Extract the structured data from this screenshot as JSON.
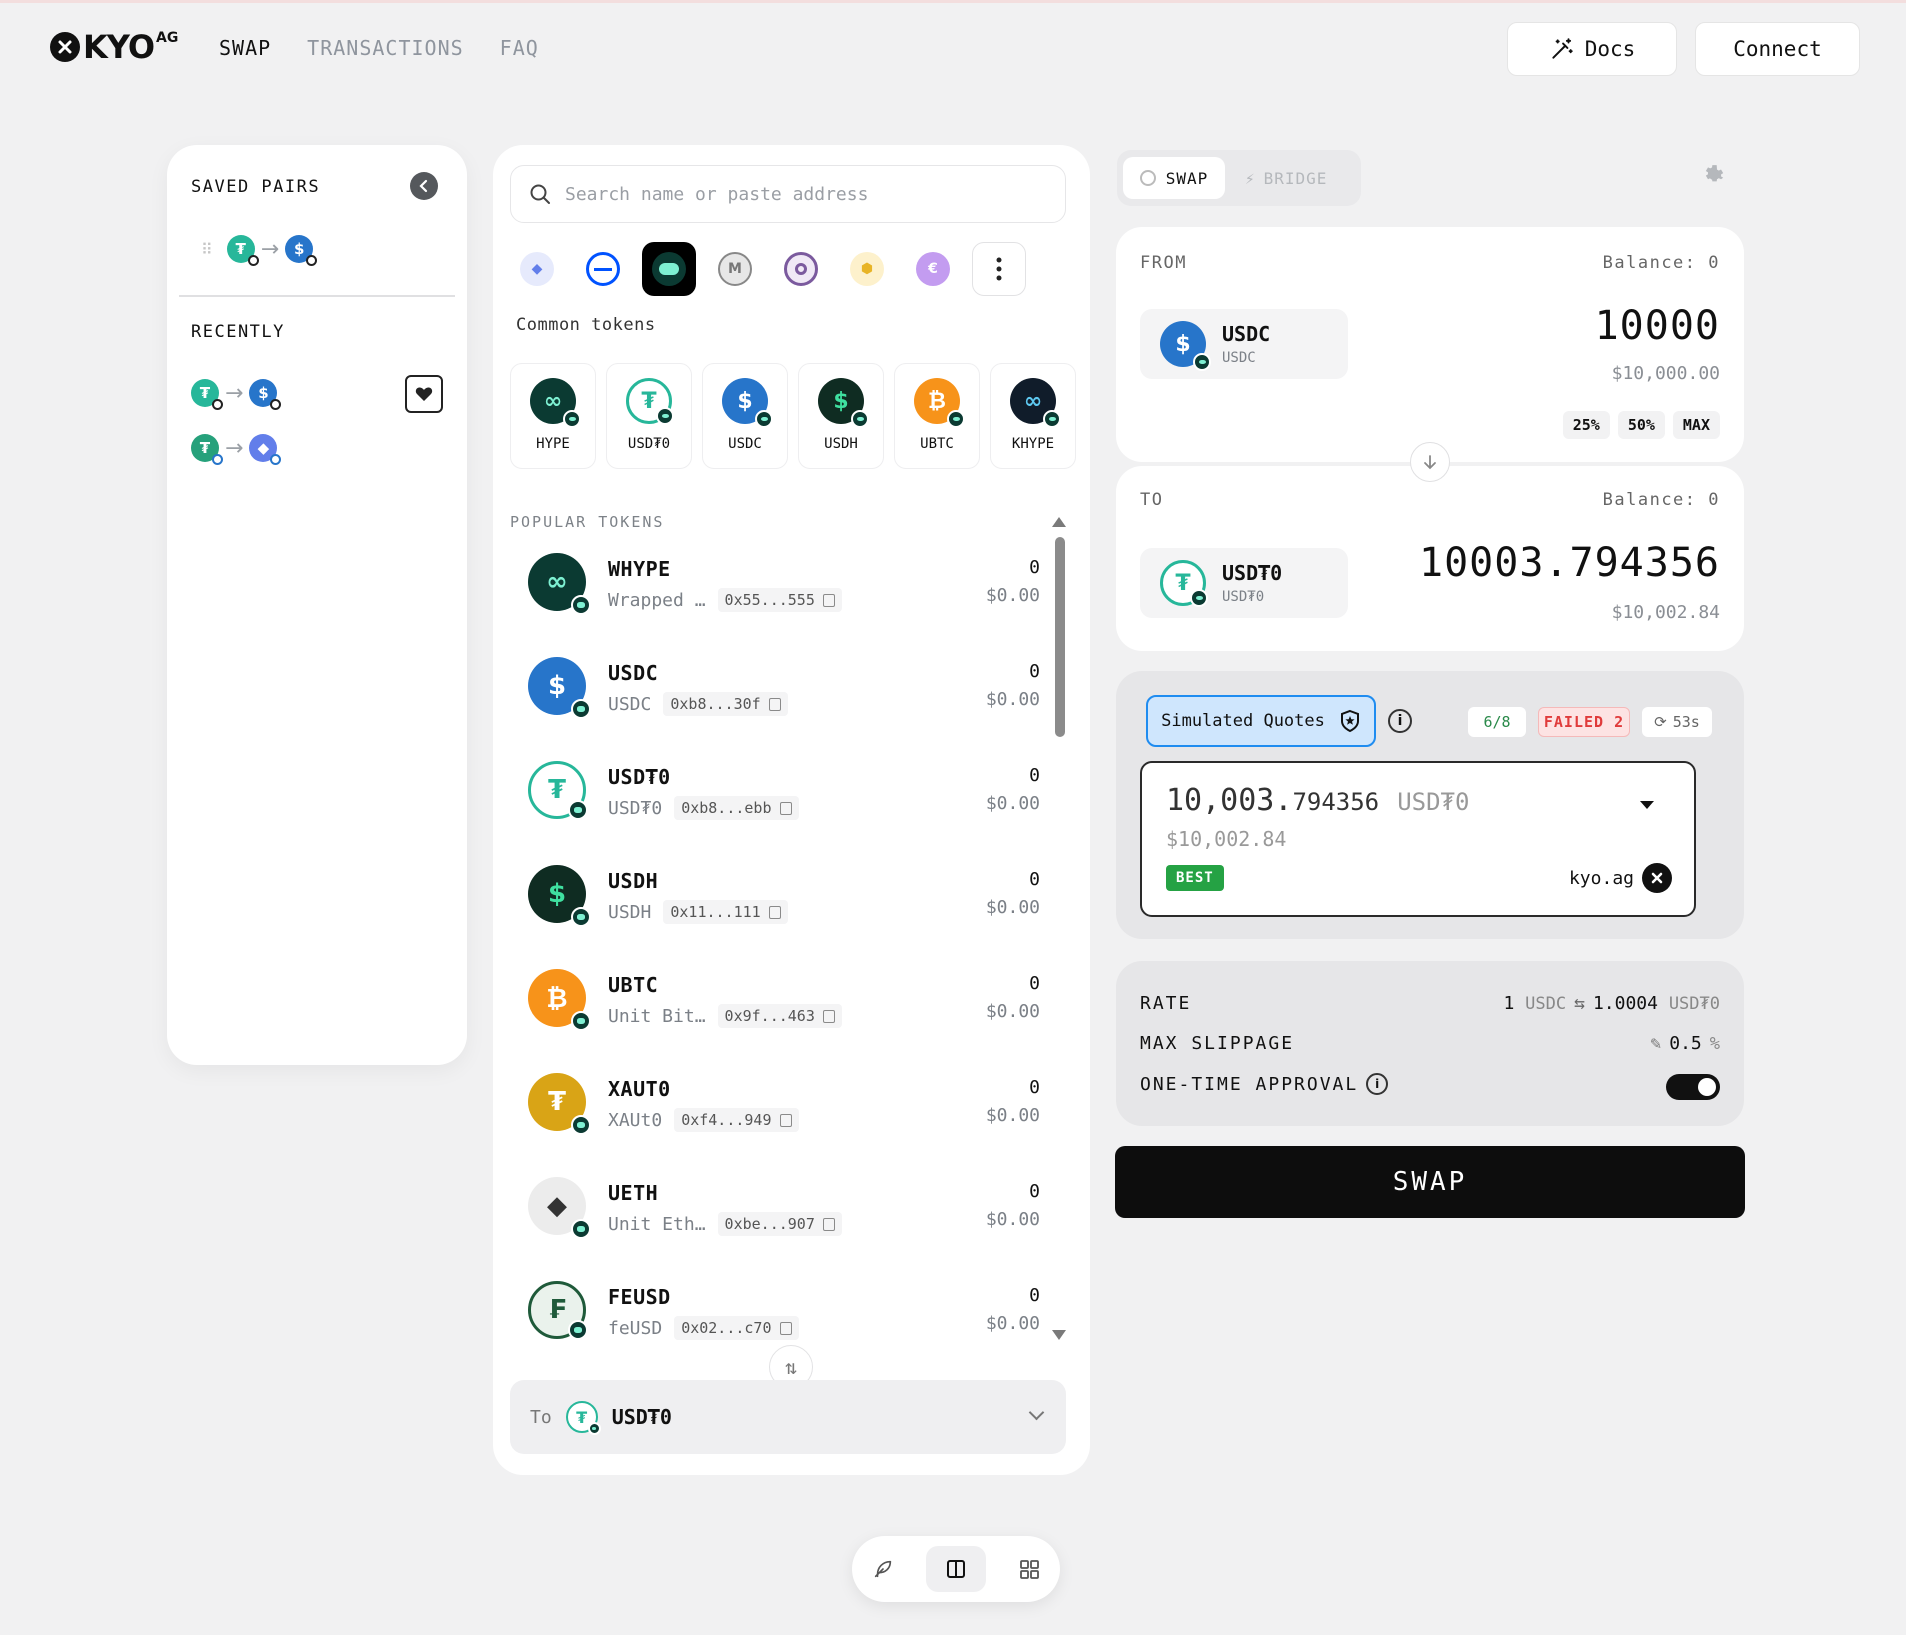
{
  "app": {
    "logo_text": "KYO",
    "logo_sup": "AG"
  },
  "nav": {
    "swap": "SWAP",
    "transactions": "TRANSACTIONS",
    "faq": "FAQ"
  },
  "header": {
    "docs_label": "Docs",
    "connect_label": "Connect"
  },
  "saved": {
    "title": "SAVED PAIRS",
    "recent_title": "RECENTLY"
  },
  "token_selector": {
    "search_placeholder": "Search name or paste address",
    "common_label": "Common tokens",
    "popular_label": "POPULAR TOKENS",
    "chains": [
      "ethereum",
      "base",
      "hyperliquid",
      "mantle",
      "hyperevm-circle",
      "bnb",
      "ethena"
    ],
    "common_tokens": [
      {
        "symbol": "HYPE",
        "color": "#0b3a32",
        "glyph": "∞"
      },
      {
        "symbol": "USD₮0",
        "color": "#27b79a",
        "glyph": "₮"
      },
      {
        "symbol": "USDC",
        "color": "#2775ca",
        "glyph": "$"
      },
      {
        "symbol": "USDH",
        "color": "#0f2c22",
        "glyph": "$"
      },
      {
        "symbol": "UBTC",
        "color": "#f7931a",
        "glyph": "₿"
      },
      {
        "symbol": "KHYPE",
        "color": "#101c2a",
        "glyph": "∞"
      }
    ],
    "popular_tokens": [
      {
        "symbol": "WHYPE",
        "name": "Wrapped …",
        "address": "0x55...555",
        "balance": "0",
        "usd": "$0.00",
        "color": "#0b3a32",
        "glyph": "∞"
      },
      {
        "symbol": "USDC",
        "name": "USDC",
        "address": "0xb8...30f",
        "balance": "0",
        "usd": "$0.00",
        "color": "#2775ca",
        "glyph": "$"
      },
      {
        "symbol": "USD₮0",
        "name": "USD₮0",
        "address": "0xb8...ebb",
        "balance": "0",
        "usd": "$0.00",
        "color": "#27b79a",
        "glyph": "₮"
      },
      {
        "symbol": "USDH",
        "name": "USDH",
        "address": "0x11...111",
        "balance": "0",
        "usd": "$0.00",
        "color": "#0f2c22",
        "glyph": "$"
      },
      {
        "symbol": "UBTC",
        "name": "Unit Bit…",
        "address": "0x9f...463",
        "balance": "0",
        "usd": "$0.00",
        "color": "#f7931a",
        "glyph": "₿"
      },
      {
        "symbol": "XAUT0",
        "name": "XAUt0",
        "address": "0xf4...949",
        "balance": "0",
        "usd": "$0.00",
        "color": "#d9a416",
        "glyph": "₮"
      },
      {
        "symbol": "UETH",
        "name": "Unit Eth…",
        "address": "0xbe...907",
        "balance": "0",
        "usd": "$0.00",
        "color": "#ececec",
        "glyph": "◆"
      },
      {
        "symbol": "FEUSD",
        "name": "feUSD",
        "address": "0x02...c70",
        "balance": "0",
        "usd": "$0.00",
        "color": "#eaf2ec",
        "glyph": "₣"
      }
    ],
    "to_label": "To",
    "to_value": "USD₮0"
  },
  "swap_panel": {
    "tab_swap": "SWAP",
    "tab_bridge": "BRIDGE",
    "from": {
      "label": "FROM",
      "balance": "Balance: 0",
      "token_name": "USDC",
      "token_symbol": "USDC",
      "amount": "10000",
      "usd": "$10,000.00",
      "pct_25": "25%",
      "pct_50": "50%",
      "pct_max": "MAX"
    },
    "to": {
      "label": "TO",
      "balance": "Balance: 0",
      "token_name": "USD₮0",
      "token_symbol": "USD₮0",
      "amount": "10003.794356",
      "usd": "$10,002.84"
    },
    "quotes": {
      "sim_label": "Simulated Quotes",
      "count": "6/8",
      "failed": "FAILED 2",
      "timer": "53s",
      "amount_int": "10,003.",
      "amount_frac": "794356",
      "amount_sym": "USD₮0",
      "usd": "$10,002.84",
      "best": "BEST",
      "source": "kyo.ag"
    },
    "rate": {
      "rate_label": "RATE",
      "rate_lhs_num": "1",
      "rate_lhs_sym": "USDC",
      "rate_rhs_num": "1.0004",
      "rate_rhs_sym": "USD₮0",
      "slippage_label": "MAX SLIPPAGE",
      "slippage_val": "0.5",
      "slippage_unit": "%",
      "approval_label": "ONE-TIME APPROVAL",
      "approval_on": true
    },
    "swap_label": "SWAP"
  },
  "colors": {
    "accent_blue": "#1f8cf0",
    "success_green": "#25a244",
    "failed_red": "#e03b3b"
  }
}
